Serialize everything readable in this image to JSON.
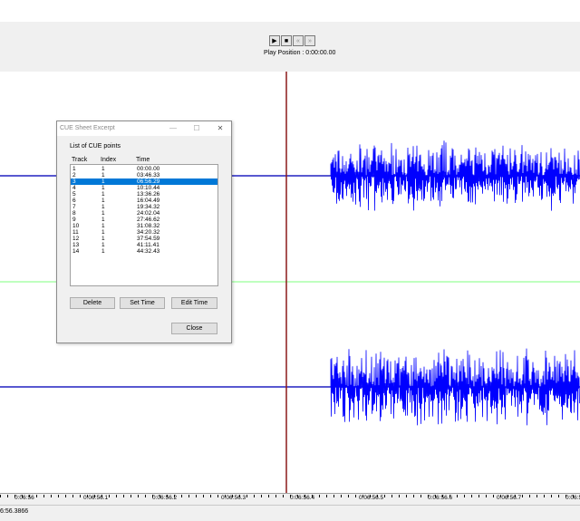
{
  "transport": {
    "play_icon": "play-icon",
    "stop_icon": "stop-icon",
    "prev_icon": "prev-cue-icon",
    "next_icon": "next-cue-icon",
    "play_position": "Play Position :  0:00:00.00"
  },
  "ruler": {
    "labels": [
      "0:06:56",
      "0:06:56.1",
      "0:06:56.2",
      "0:06:56.3",
      "0:06:56.4",
      "0:06:56.5",
      "0:06:56.6",
      "0:06:56.7",
      "0:06:56.8"
    ]
  },
  "status": {
    "cursor_time": "6:56.3866"
  },
  "colors": {
    "waveform": "#0000ff",
    "center_line": "#2020c0",
    "channel_divider": "#7fff7f",
    "cursor": "#8b1a1a",
    "selection": "#0078d7"
  },
  "dialog": {
    "title": "CUE Sheet Excerpt",
    "minimize_glyph": "—",
    "maximize_glyph": "☐",
    "close_glyph": "✕",
    "list_caption": "List of CUE points",
    "columns": {
      "track": "Track",
      "index": "Index",
      "time": "Time"
    },
    "rows": [
      {
        "track": "1",
        "index": "1",
        "time": "00:00.00"
      },
      {
        "track": "2",
        "index": "1",
        "time": "03:46.33"
      },
      {
        "track": "3",
        "index": "1",
        "time": "06:56.29"
      },
      {
        "track": "4",
        "index": "1",
        "time": "10:10.44"
      },
      {
        "track": "5",
        "index": "1",
        "time": "13:36.26"
      },
      {
        "track": "6",
        "index": "1",
        "time": "16:04.49"
      },
      {
        "track": "7",
        "index": "1",
        "time": "19:34.32"
      },
      {
        "track": "8",
        "index": "1",
        "time": "24:02.04"
      },
      {
        "track": "9",
        "index": "1",
        "time": "27:46.62"
      },
      {
        "track": "10",
        "index": "1",
        "time": "31:08.32"
      },
      {
        "track": "11",
        "index": "1",
        "time": "34:20.32"
      },
      {
        "track": "12",
        "index": "1",
        "time": "37:54.59"
      },
      {
        "track": "13",
        "index": "1",
        "time": "41:11.41"
      },
      {
        "track": "14",
        "index": "1",
        "time": "44:32.43"
      }
    ],
    "selected_row": 2,
    "buttons": {
      "delete": "Delete",
      "set_time": "Set Time",
      "edit_time": "Edit Time",
      "close": "Close"
    }
  }
}
